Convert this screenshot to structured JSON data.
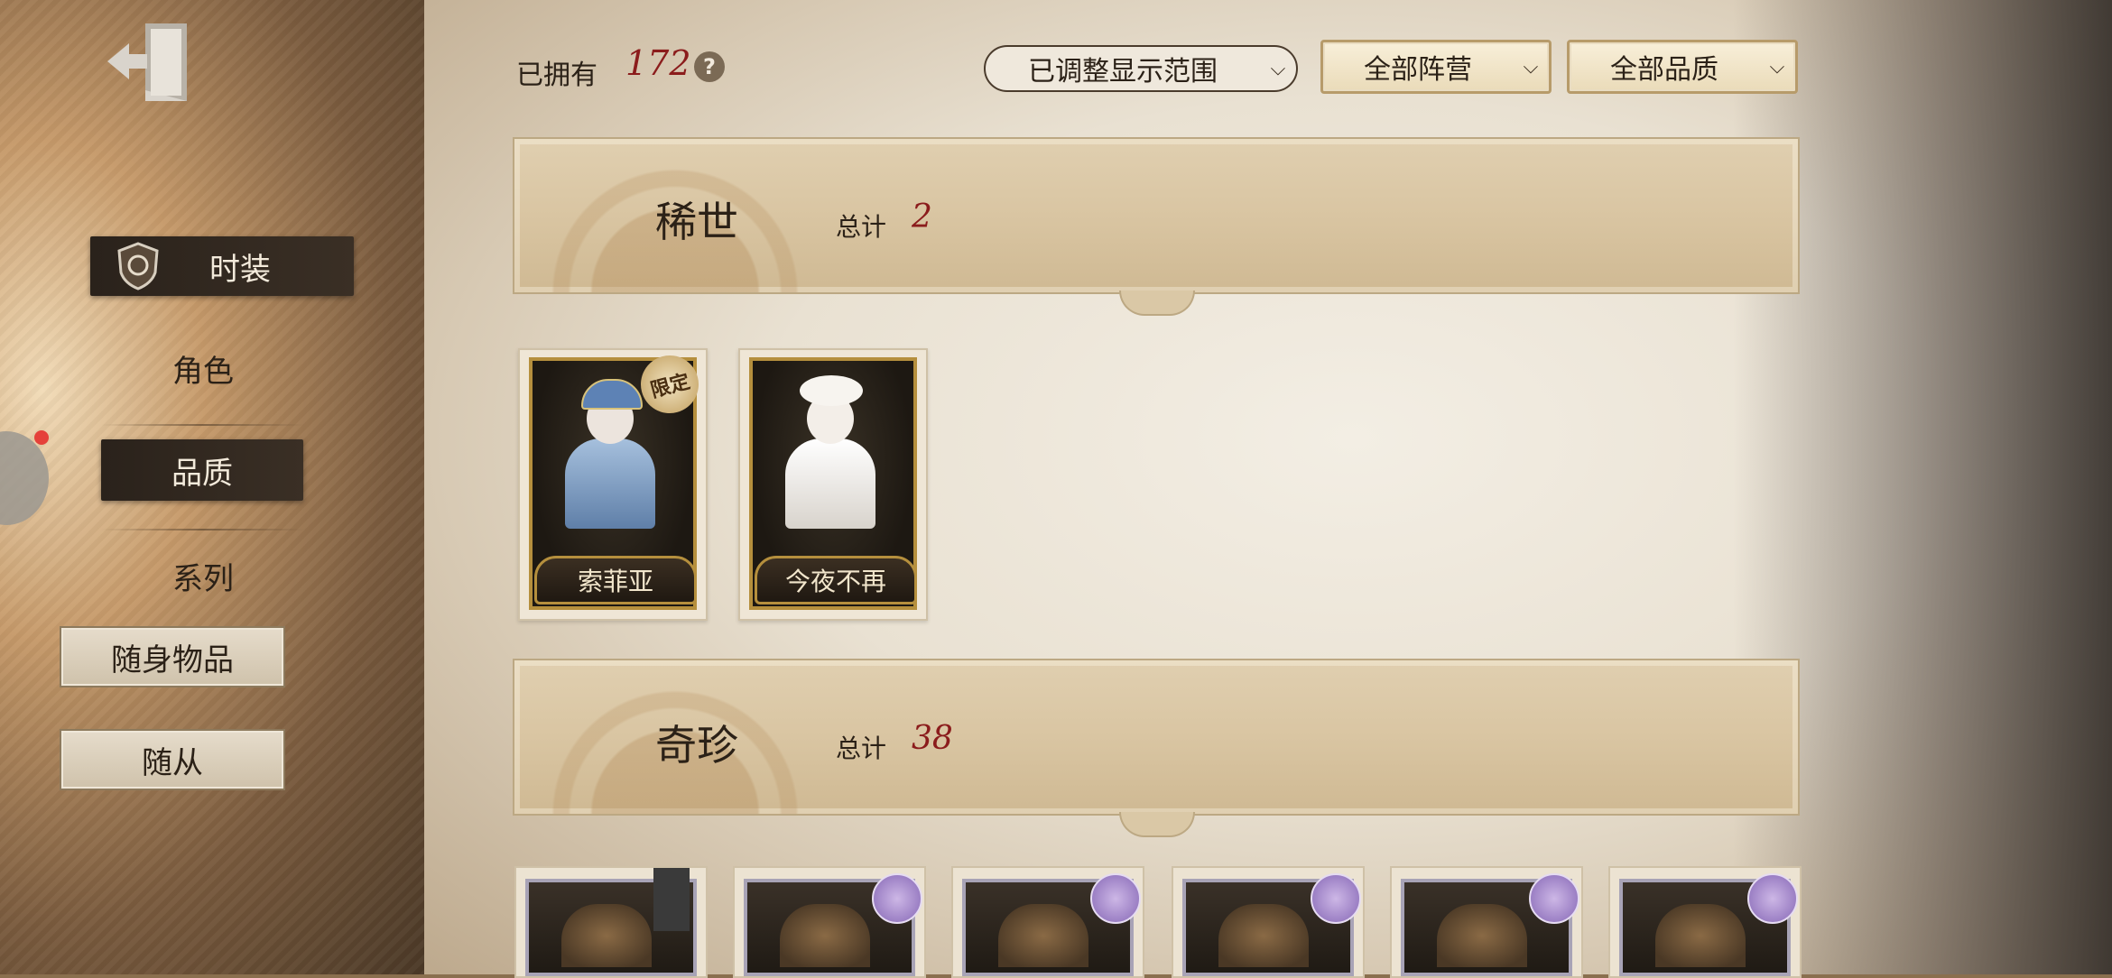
{
  "sidebar": {
    "items": [
      {
        "label": "时装",
        "state": "active"
      },
      {
        "label": "角色"
      },
      {
        "label": "品质",
        "state": "selected"
      },
      {
        "label": "系列"
      },
      {
        "label": "随身物品"
      },
      {
        "label": "随从"
      }
    ]
  },
  "header": {
    "owned_label": "已拥有",
    "owned_count": "172",
    "help": "?",
    "filters": {
      "range": "已调整显示范围",
      "faction": "全部阵营",
      "quality": "全部品质"
    }
  },
  "sections": [
    {
      "title": "稀世",
      "total_label": "总计",
      "total": "2",
      "cards": [
        {
          "name": "索菲亚",
          "badge": "限定",
          "dress_color": "#7fa0c8"
        },
        {
          "name": "今夜不再",
          "dress_color": "#f2efe9"
        }
      ]
    },
    {
      "title": "奇珍",
      "total_label": "总计",
      "total": "38"
    }
  ],
  "colors": {
    "accent_red": "#8b1c1c",
    "gold": "#b58f3d",
    "purple_seal": "#9b7fc4"
  }
}
